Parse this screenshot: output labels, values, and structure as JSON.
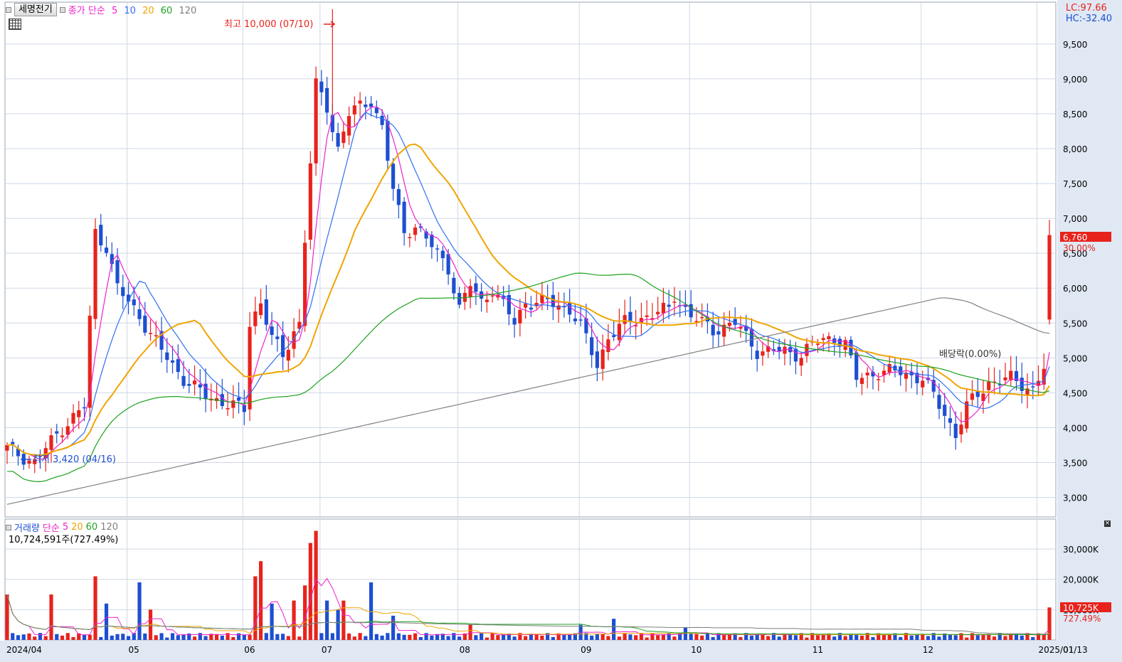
{
  "title": "세명전기",
  "price_legend": {
    "label": "종가 단순",
    "periods": [
      "5",
      "10",
      "20",
      "60",
      "120"
    ]
  },
  "volume_legend": {
    "label1": "거래량",
    "label2": "단순",
    "periods": [
      "5",
      "20",
      "60",
      "120"
    ]
  },
  "volume_info": "10,724,591주(727.49%)",
  "lc": "LC:97.66",
  "hc": "HC:-32.40",
  "annotations": {
    "high": "최고 10,000 (07/10)",
    "low": "최저 3,420 (04/16)",
    "dividend": "배당락(0.00%)"
  },
  "current": {
    "price_label": "6,760",
    "price_pct": "30.00%",
    "volume_label": "10,725K",
    "volume_pct": "727.49%"
  },
  "colors": {
    "up": "#e8231c",
    "down": "#1e4fd2",
    "ma5": "#ee22cc",
    "ma10": "#2f6ff0",
    "ma20": "#f0a500",
    "ma60": "#1ea21e",
    "ma120": "#808080",
    "grid": "#cfd8e6",
    "axisbg": "#dfe8f3"
  },
  "chart_data": [
    {
      "type": "candlestick",
      "title": "세명전기",
      "y_ticks": [
        3000,
        3500,
        4000,
        4500,
        5000,
        5500,
        6000,
        6500,
        7000,
        7500,
        8000,
        8500,
        9000,
        9500
      ],
      "y_tick_labels": [
        "3,000",
        "3,500",
        "4,000",
        "4,500",
        "5,000",
        "5,500",
        "6,000",
        "6,500",
        "7,000",
        "7,500",
        "8,000",
        "8,500",
        "9,000",
        "9,500"
      ],
      "ylim": [
        2720,
        10100
      ],
      "x_labels": [
        "2024/04",
        "05",
        "06",
        "07",
        "08",
        "09",
        "10",
        "11",
        "12",
        "2025/01",
        "01/13"
      ],
      "series": [
        {
          "name": "5",
          "data_hint": "moving average"
        },
        {
          "name": "10"
        },
        {
          "name": "20"
        },
        {
          "name": "60"
        },
        {
          "name": "120"
        }
      ],
      "anchors": [
        {
          "date": "04/16",
          "price": 3420,
          "label": "최저"
        },
        {
          "date": "05/10",
          "price": 6950
        },
        {
          "date": "06/05",
          "price": 4250
        },
        {
          "date": "07/01",
          "price": 9400
        },
        {
          "date": "07/10",
          "price": 10000,
          "label": "최고"
        },
        {
          "date": "08/05",
          "price": 6100
        },
        {
          "date": "09/06",
          "price": 4850
        },
        {
          "date": "09/30",
          "price": 6100
        },
        {
          "date": "12/09",
          "price": 3850
        },
        {
          "date": "01/13",
          "price": 6760,
          "label": "current"
        }
      ],
      "last_close": 6760,
      "last_change_pct": 30.0
    },
    {
      "type": "bar",
      "title": "거래량",
      "y_ticks": [
        10000,
        20000,
        30000
      ],
      "y_tick_labels": [
        "10,000K",
        "20,000K",
        "30,000K"
      ],
      "ylim": [
        0,
        38000
      ],
      "units": "K shares",
      "last_volume": 10725,
      "last_volume_pct": 727.49
    }
  ]
}
